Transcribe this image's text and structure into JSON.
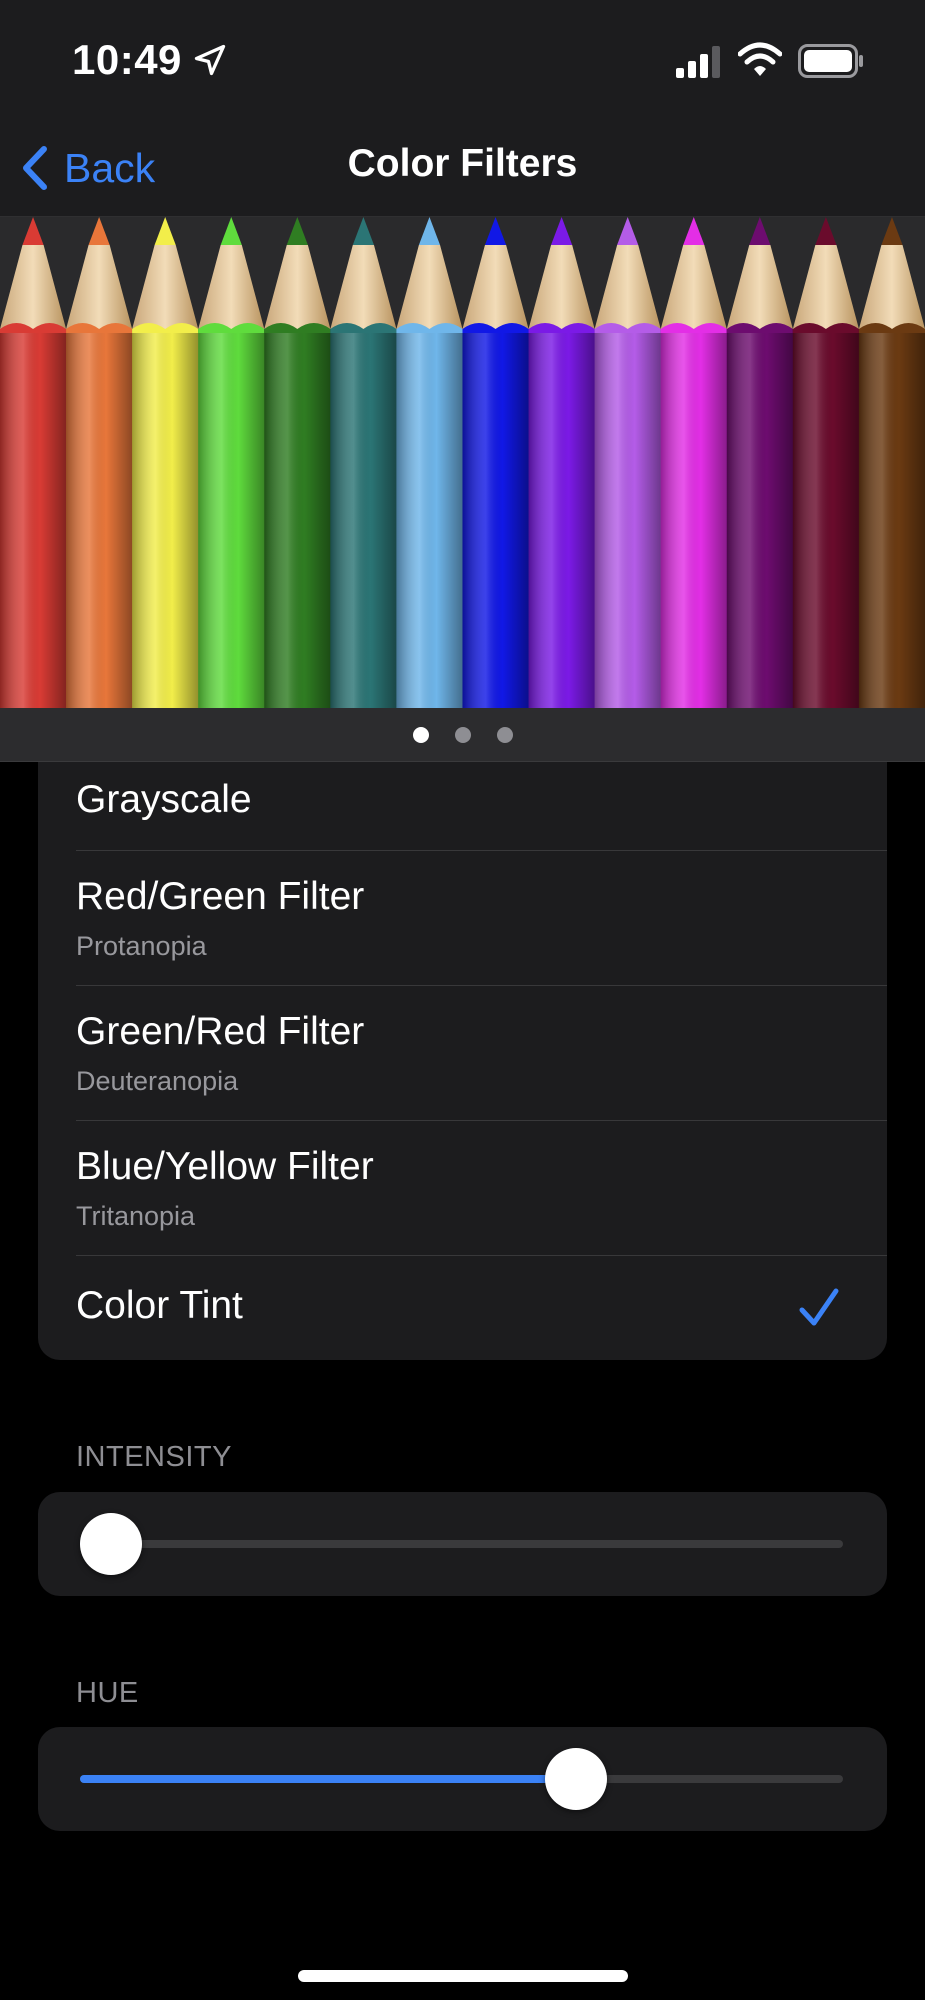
{
  "status_bar": {
    "time": "10:49"
  },
  "nav": {
    "back_label": "Back",
    "title": "Color Filters"
  },
  "carousel": {
    "page_count": 3,
    "active_page": 0,
    "pencil_colors": [
      "#d93b34",
      "#e8763a",
      "#f2ee4a",
      "#5fdc3d",
      "#2f7d22",
      "#2b7575",
      "#6fb6ea",
      "#1118e6",
      "#7b1ae6",
      "#b45ce8",
      "#e32ee6",
      "#6d0c6f",
      "#6a0b2c",
      "#6b3a12"
    ]
  },
  "filters": {
    "options": [
      {
        "title": "Grayscale",
        "subtitle": ""
      },
      {
        "title": "Red/Green Filter",
        "subtitle": "Protanopia"
      },
      {
        "title": "Green/Red Filter",
        "subtitle": "Deuteranopia"
      },
      {
        "title": "Blue/Yellow Filter",
        "subtitle": "Tritanopia"
      },
      {
        "title": "Color Tint",
        "subtitle": ""
      }
    ],
    "selected": "Color Tint"
  },
  "intensity": {
    "label": "INTENSITY",
    "value": 0.04
  },
  "hue": {
    "label": "HUE",
    "value": 0.65
  },
  "colors": {
    "accent": "#3b82f6",
    "background": "#000000",
    "card": "#1c1c1e"
  }
}
